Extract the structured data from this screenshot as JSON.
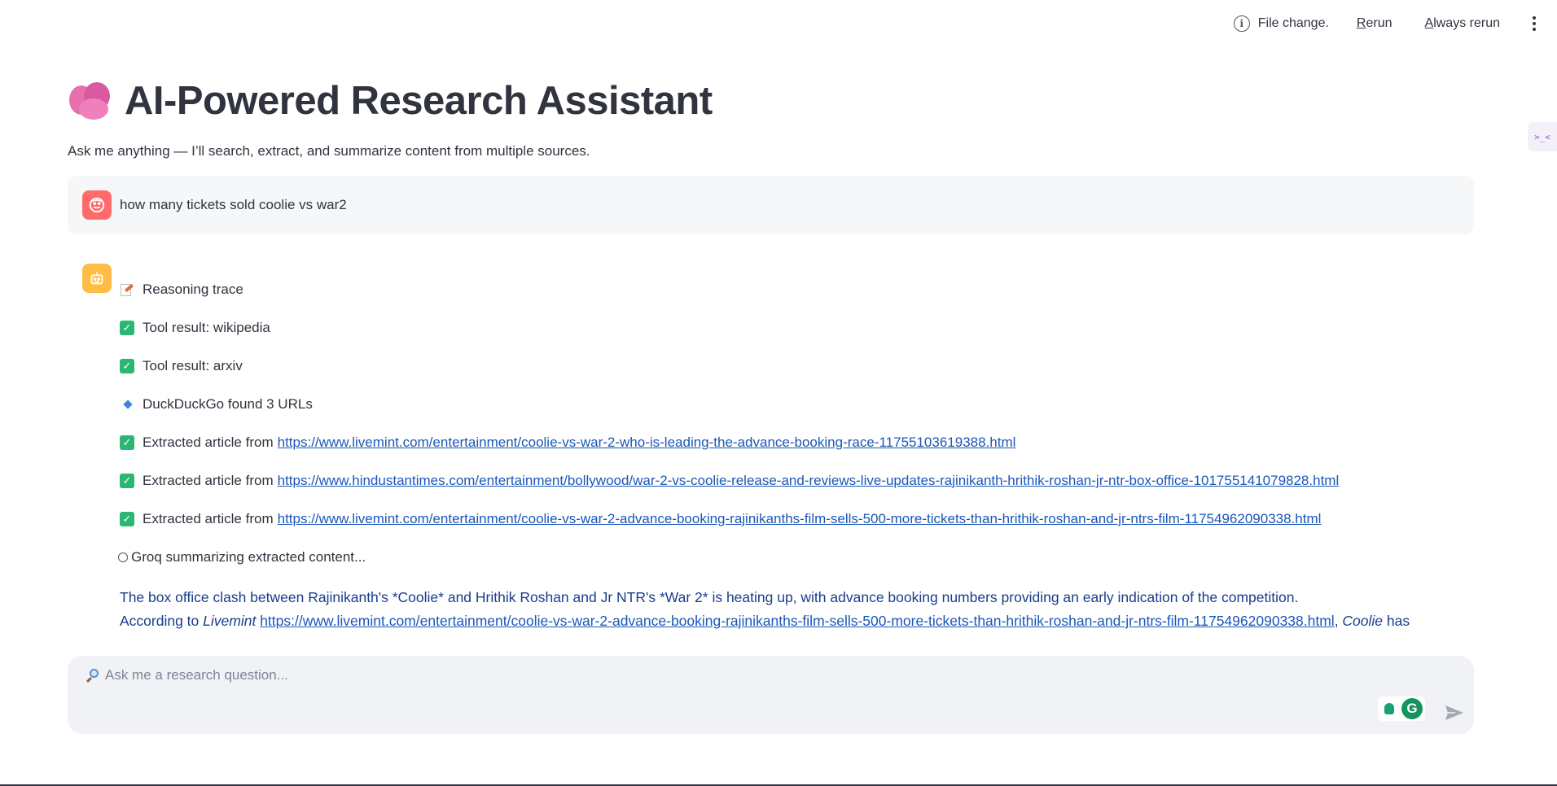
{
  "toolbar": {
    "status_text": "File change.",
    "rerun_first": "R",
    "rerun_rest": "erun",
    "always_first": "A",
    "always_rest": "lways rerun"
  },
  "header": {
    "title": "AI-Powered Research Assistant",
    "subtitle": "Ask me anything — I’ll search, extract, and summarize content from multiple sources."
  },
  "user_message": {
    "text": "how many tickets sold coolie vs war2"
  },
  "assistant": {
    "trace_title": "Reasoning trace",
    "tool_wikipedia": "Tool result: wikipedia",
    "tool_arxiv": "Tool result: arxiv",
    "ddg": "DuckDuckGo found 3 URLs",
    "extracted_prefix": "Extracted article from",
    "urls": [
      "https://www.livemint.com/entertainment/coolie-vs-war-2-who-is-leading-the-advance-booking-race-11755103619388.html",
      "https://www.hindustantimes.com/entertainment/bollywood/war-2-vs-coolie-release-and-reviews-live-updates-rajinikanth-hrithik-roshan-jr-ntr-box-office-101755141079828.html",
      "https://www.livemint.com/entertainment/coolie-vs-war-2-advance-booking-rajinikanths-film-sells-500-more-tickets-than-hrithik-roshan-and-jr-ntrs-film-11754962090338.html"
    ],
    "groq": "Groq summarizing extracted content...",
    "summary_line1": "The box office clash between Rajinikanth's *Coolie* and Hrithik Roshan and Jr NTR's *War 2* is heating up, with advance booking numbers providing an early indication of the competition.",
    "summary_line2_a": "According to ",
    "summary_line2_source": "Livemint",
    "summary_line2_link": "https://www.livemint.com/entertainment/coolie-vs-war-2-advance-booking-rajinikanths-film-sells-500-more-tickets-than-hrithik-roshan-and-jr-ntrs-film-11754962090338.html",
    "summary_line2_b": ", ",
    "summary_line2_film": "Coolie",
    "summary_line2_c": " has"
  },
  "chat_input": {
    "placeholder": "Ask me a research question..."
  },
  "colors": {
    "user_avatar": "#ff6b6b",
    "bot_avatar": "#ffbd45",
    "link": "#1a57b8",
    "check": "#2bb673"
  }
}
